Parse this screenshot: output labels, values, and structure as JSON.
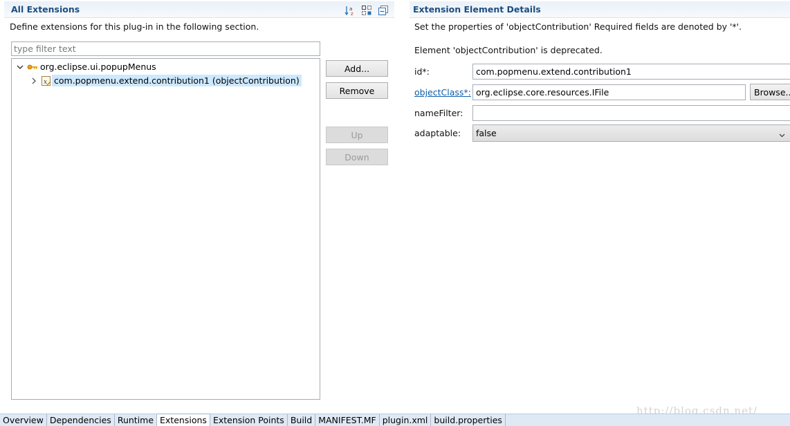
{
  "left_section": {
    "title": "All Extensions",
    "description": "Define extensions for this plug-in in the following section.",
    "filter_placeholder": "type filter text",
    "tools": [
      "sort-alpha-icon",
      "show-extension-element-icon",
      "collapse-all-icon"
    ],
    "tree": [
      {
        "label": "org.eclipse.ui.popupMenus",
        "expanded": true,
        "icon": "extension-plug-icon"
      },
      {
        "label": "com.popmenu.extend.contribution1 (objectContribution)",
        "expanded": false,
        "selected": true,
        "icon": "element-x-icon"
      }
    ],
    "buttons": {
      "add": "Add...",
      "remove": "Remove",
      "up": "Up",
      "down": "Down"
    }
  },
  "right_section": {
    "title": "Extension Element Details",
    "description": "Set the properties of 'objectContribution' Required fields are denoted by '*'.",
    "deprecated_note": "Element 'objectContribution' is deprecated.",
    "fields": {
      "id_label": "id*:",
      "id_value": "com.popmenu.extend.contribution1",
      "objectclass_label": "objectClass*:",
      "objectclass_value": "org.eclipse.core.resources.IFile",
      "browse_label": "Browse...",
      "namefilter_label": "nameFilter:",
      "namefilter_value": "",
      "adaptable_label": "adaptable:",
      "adaptable_value": "false"
    }
  },
  "watermark": "http://blog.csdn.net/",
  "tabs": [
    "Overview",
    "Dependencies",
    "Runtime",
    "Extensions",
    "Extension Points",
    "Build",
    "MANIFEST.MF",
    "plugin.xml",
    "build.properties"
  ],
  "active_tab": "Extensions",
  "colors": {
    "header_text": "#1c4e80",
    "selection": "#cde8ff",
    "link": "#0b5ea8",
    "tabbar": "#dfe9f5"
  }
}
